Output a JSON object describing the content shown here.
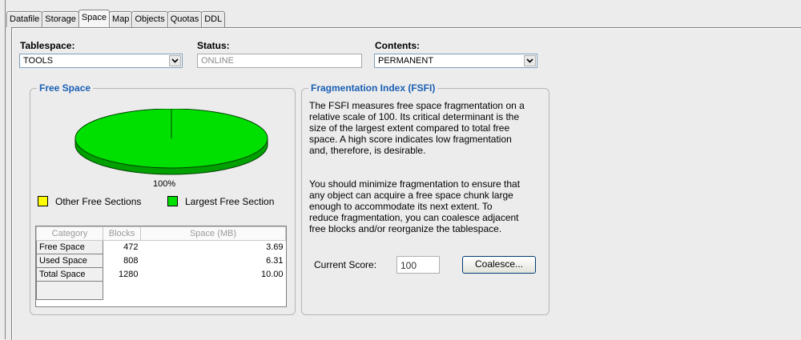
{
  "tabs": [
    "Datafile",
    "Storage",
    "Space",
    "Map",
    "Objects",
    "Quotas",
    "DDL"
  ],
  "active_tab": "Space",
  "tablespace": {
    "label": "Tablespace:",
    "value": "TOOLS"
  },
  "status": {
    "label": "Status:",
    "value": "ONLINE"
  },
  "contents": {
    "label": "Contents:",
    "value": "PERMANENT"
  },
  "free_space": {
    "title": "Free Space",
    "pie_label": "100%",
    "legend": [
      {
        "label": "Other Free Sections",
        "color": "#ffff00"
      },
      {
        "label": "Largest Free Section",
        "color": "#00e000"
      }
    ],
    "table": {
      "headers": [
        "Category",
        "Blocks",
        "Space (MB)"
      ],
      "rows": [
        {
          "category": "Free Space",
          "blocks": "472",
          "space": "3.69"
        },
        {
          "category": "Used Space",
          "blocks": "808",
          "space": "6.31"
        },
        {
          "category": "Total Space",
          "blocks": "1280",
          "space": "10.00"
        }
      ]
    }
  },
  "fsfi": {
    "title": "Fragmentation Index (FSFI)",
    "description_1": [
      "The FSFI measures free space fragmentation on a",
      "relative scale of 100.  Its critical determinant is the",
      "size of the largest extent compared to total free",
      "space.  A high score indicates low fragmentation",
      "and, therefore, is desirable."
    ],
    "description_2": [
      "You should minimize fragmentation to ensure that",
      "any object can acquire a free space chunk large",
      "enough to accommodate its next extent.  To",
      "reduce fragmentation, you can coalesce adjacent",
      "free blocks and/or reorganize the tablespace."
    ],
    "score_label": "Current Score:",
    "score_value": "100",
    "coalesce_label": "Coalesce..."
  },
  "colors": {
    "accent": "#1a5fb4",
    "pie_green": "#00e000",
    "pie_green_dark": "#00a000"
  }
}
